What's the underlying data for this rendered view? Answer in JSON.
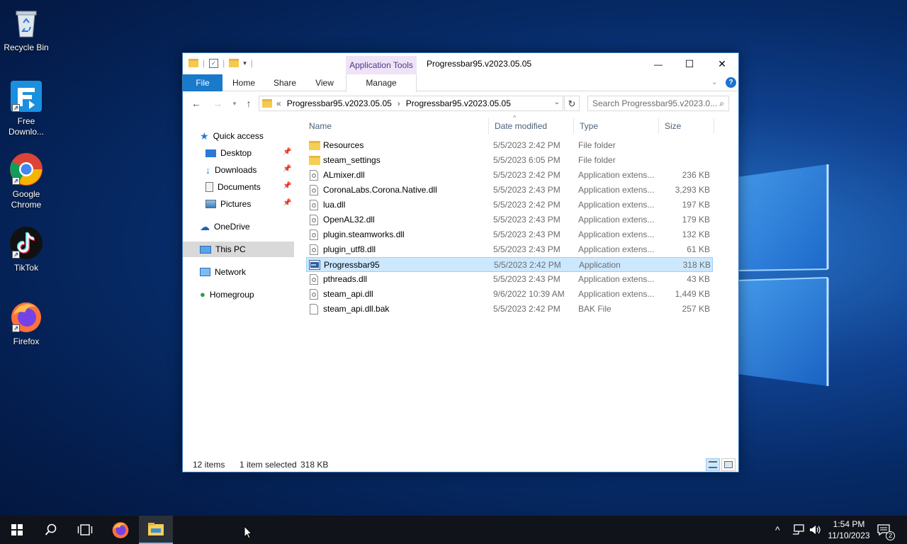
{
  "desktop": {
    "icons": [
      {
        "label": "Recycle Bin",
        "icon": "recycle-bin-icon"
      },
      {
        "label": "Free Downlo...",
        "icon": "free-download-manager-icon"
      },
      {
        "label": "Google Chrome",
        "icon": "chrome-icon"
      },
      {
        "label": "TikTok",
        "icon": "tiktok-icon"
      },
      {
        "label": "Firefox",
        "icon": "firefox-icon"
      }
    ]
  },
  "window": {
    "title": "Progressbar95.v2023.05.05",
    "contextual_group": "Application Tools",
    "controls": {
      "minimize": "—",
      "maximize": "☐",
      "close": "✕"
    },
    "ribbon_tabs": {
      "file": "File",
      "home": "Home",
      "share": "Share",
      "view": "View",
      "manage": "Manage"
    },
    "address": {
      "prefix": "«",
      "crumbs": [
        "Progressbar95.v2023.05.05",
        "Progressbar95.v2023.05.05"
      ],
      "separator": "›"
    },
    "search_placeholder": "Search Progressbar95.v2023.0...",
    "nav": {
      "quick_access": "Quick access",
      "desktop": "Desktop",
      "downloads": "Downloads",
      "documents": "Documents",
      "pictures": "Pictures",
      "onedrive": "OneDrive",
      "this_pc": "This PC",
      "network": "Network",
      "homegroup": "Homegroup"
    },
    "columns": {
      "name": "Name",
      "date": "Date modified",
      "type": "Type",
      "size": "Size"
    },
    "files": [
      {
        "name": "Resources",
        "date": "5/5/2023 2:42 PM",
        "type": "File folder",
        "size": "",
        "kind": "folder"
      },
      {
        "name": "steam_settings",
        "date": "5/5/2023 6:05 PM",
        "type": "File folder",
        "size": "",
        "kind": "folder"
      },
      {
        "name": "ALmixer.dll",
        "date": "5/5/2023 2:42 PM",
        "type": "Application extens...",
        "size": "236 KB",
        "kind": "dll"
      },
      {
        "name": "CoronaLabs.Corona.Native.dll",
        "date": "5/5/2023 2:43 PM",
        "type": "Application extens...",
        "size": "3,293 KB",
        "kind": "dll"
      },
      {
        "name": "lua.dll",
        "date": "5/5/2023 2:42 PM",
        "type": "Application extens...",
        "size": "197 KB",
        "kind": "dll"
      },
      {
        "name": "OpenAL32.dll",
        "date": "5/5/2023 2:43 PM",
        "type": "Application extens...",
        "size": "179 KB",
        "kind": "dll"
      },
      {
        "name": "plugin.steamworks.dll",
        "date": "5/5/2023 2:43 PM",
        "type": "Application extens...",
        "size": "132 KB",
        "kind": "dll"
      },
      {
        "name": "plugin_utf8.dll",
        "date": "5/5/2023 2:43 PM",
        "type": "Application extens...",
        "size": "61 KB",
        "kind": "dll"
      },
      {
        "name": "Progressbar95",
        "date": "5/5/2023 2:42 PM",
        "type": "Application",
        "size": "318 KB",
        "kind": "exe"
      },
      {
        "name": "pthreads.dll",
        "date": "5/5/2023 2:43 PM",
        "type": "Application extens...",
        "size": "43 KB",
        "kind": "dll"
      },
      {
        "name": "steam_api.dll",
        "date": "9/6/2022 10:39 AM",
        "type": "Application extens...",
        "size": "1,449 KB",
        "kind": "dll"
      },
      {
        "name": "steam_api.dll.bak",
        "date": "5/5/2023 2:42 PM",
        "type": "BAK File",
        "size": "257 KB",
        "kind": "file"
      }
    ],
    "status": {
      "count": "12 items",
      "selection": "1 item selected",
      "selection_size": "318 KB"
    }
  },
  "taskbar": {
    "time": "1:54 PM",
    "date": "11/10/2023",
    "notification_count": "2"
  }
}
